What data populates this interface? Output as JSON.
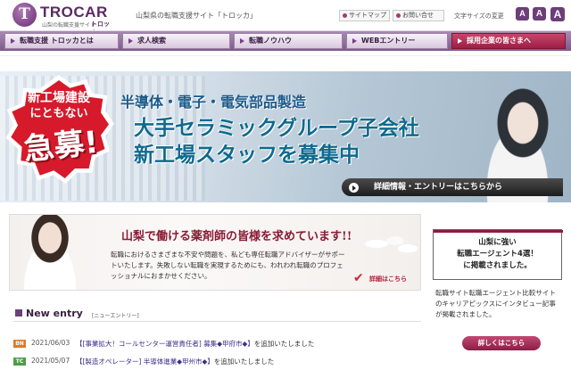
{
  "header": {
    "logo": {
      "word": "TROCAR",
      "sub": "山梨の転職支援サイト",
      "kana": "トロッカ",
      "mark": "T"
    },
    "tagline": "山梨県の転職支援サイト「トロッカ」",
    "sitemap": "サイトマップ",
    "contact": "お問い合せ",
    "fontsize_label": "文字サイズの変更",
    "fontsize_buttons": [
      "A",
      "A",
      "A"
    ]
  },
  "nav": [
    "転職支援 トロッカとは",
    "求人検索",
    "転職ノウハウ",
    "WEBエントリー",
    "採用企業の皆さまへ"
  ],
  "banner": {
    "star_line1": "新工場建設",
    "star_line2": "にともない",
    "star_big": "急募!",
    "line1": "半導体・電子・電気部品製造",
    "line2": "大手セラミックグループ子会社",
    "line3": "新工場スタッフを募集中",
    "button": "詳細情報・エントリーはこちらから"
  },
  "pharmacist": {
    "title": "山梨で働ける薬剤師の皆様を求めています!!",
    "body": "転職におけるさまざまな不安や問題を、私ども専任転職アドバイザーがサポートいたします。失敗しない転職を実現するためにも、われわれ転職のプロフェッショナルにおまかせください。",
    "link": "詳細はこちら"
  },
  "new_entry": {
    "title": "New entry",
    "sub": "[ニューエントリー]",
    "items": [
      {
        "badge": "BN",
        "date": "2021/06/03",
        "link": "【[事業拡大！コールセンター運営責任者] 募集◆甲府市◆】",
        "suffix": "を追加いたしました"
      },
      {
        "badge": "TC",
        "date": "2021/05/07",
        "link": "【[製造オペレーター] 半導体進業◆甲州市◆】",
        "suffix": "を追加いたしました"
      }
    ]
  },
  "sidebar": {
    "line1": "山梨に強い",
    "line2": "転職エージェント4選！",
    "line3": "に掲載されました。",
    "desc": "転職サイト転職エージェント比較サイトのキャリアピックスにインタビュー記事が掲載されました。",
    "button": "詳しくはこちら"
  }
}
